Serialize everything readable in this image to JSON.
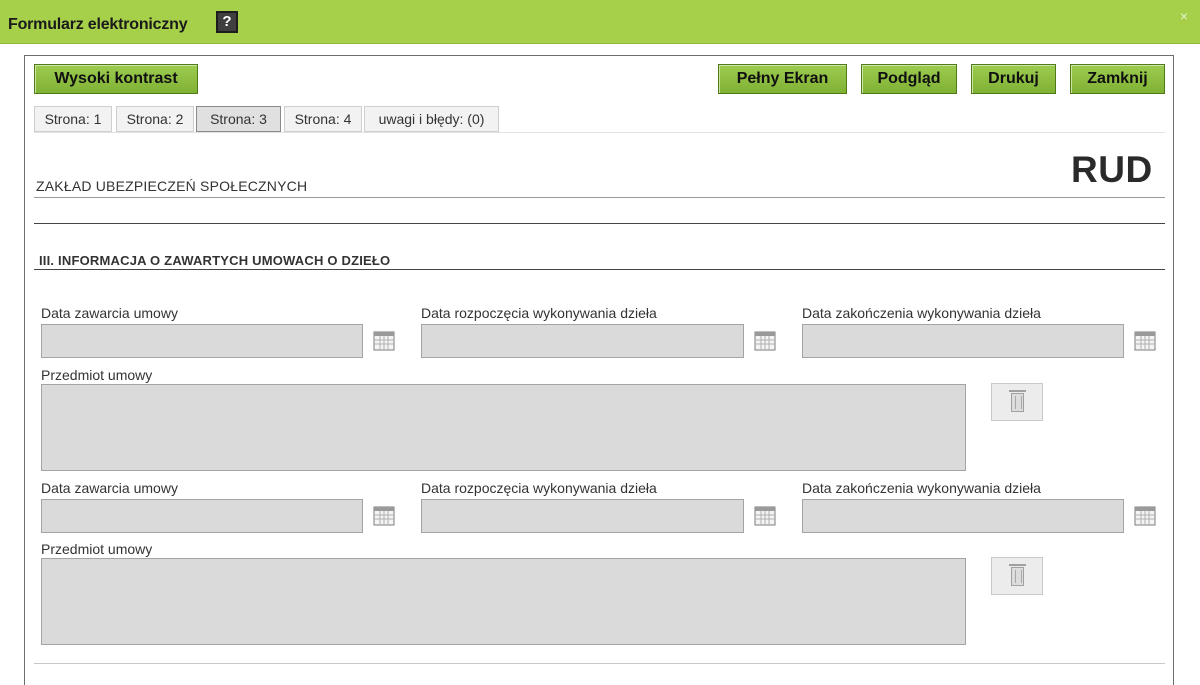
{
  "window": {
    "title": "Formularz elektroniczny",
    "help_icon": "?",
    "close_icon": "×"
  },
  "toolbar": {
    "high_contrast": "Wysoki kontrast",
    "fullscreen": "Pełny Ekran",
    "preview": "Podgląd",
    "print": "Drukuj",
    "close": "Zamknij"
  },
  "tabs": [
    {
      "label": "Strona: 1",
      "active": false
    },
    {
      "label": "Strona: 2",
      "active": false
    },
    {
      "label": "Strona: 3",
      "active": true
    },
    {
      "label": "Strona: 4",
      "active": false
    },
    {
      "label": "uwagi i błędy: (0)",
      "active": false
    }
  ],
  "form": {
    "organization": "ZAKŁAD UBEZPIECZEŃ SPOŁECZNYCH",
    "form_code": "RUD",
    "section_title": "III. INFORMACJA O ZAWARTYCH UMOWACH O DZIEŁO",
    "contracts": [
      {
        "date_signed_label": "Data zawarcia umowy",
        "date_signed_value": "",
        "date_start_label": "Data rozpoczęcia wykonywania dzieła",
        "date_start_value": "",
        "date_end_label": "Data zakończenia wykonywania dzieła",
        "date_end_value": "",
        "subject_label": "Przedmiot umowy",
        "subject_value": ""
      },
      {
        "date_signed_label": "Data zawarcia umowy",
        "date_signed_value": "",
        "date_start_label": "Data rozpoczęcia wykonywania dzieła",
        "date_start_value": "",
        "date_end_label": "Data zakończenia wykonywania dzieła",
        "date_end_value": "",
        "subject_label": "Przedmiot umowy",
        "subject_value": ""
      }
    ]
  },
  "icons": {
    "help": "help-icon",
    "close": "close-icon",
    "calendar": "calendar-icon",
    "delete": "trash-icon"
  },
  "colors": {
    "titlebar": "#a6cf4a",
    "button": "#8bbf3f",
    "field": "#dadada"
  }
}
